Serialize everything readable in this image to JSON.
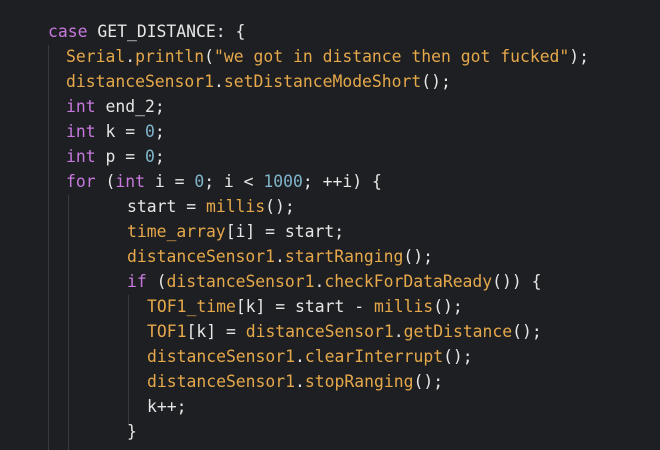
{
  "code": {
    "lines": [
      [
        {
          "t": "case",
          "c": "kw"
        },
        {
          "t": " GET_DISTANCE: {",
          "c": "id"
        }
      ],
      [
        {
          "t": "Serial",
          "c": "ob"
        },
        {
          "t": ".",
          "c": "pu"
        },
        {
          "t": "println",
          "c": "fn"
        },
        {
          "t": "(",
          "c": "pu"
        },
        {
          "t": "\"we got in distance then got fucked\"",
          "c": "st"
        },
        {
          "t": ");",
          "c": "pu"
        }
      ],
      [
        {
          "t": "distanceSensor1",
          "c": "ob"
        },
        {
          "t": ".",
          "c": "pu"
        },
        {
          "t": "setDistanceModeShort",
          "c": "fn"
        },
        {
          "t": "();",
          "c": "pu"
        }
      ],
      [
        {
          "t": "int",
          "c": "ty"
        },
        {
          "t": " end_2;",
          "c": "id"
        }
      ],
      [
        {
          "t": "int",
          "c": "ty"
        },
        {
          "t": " k = ",
          "c": "id"
        },
        {
          "t": "0",
          "c": "nm"
        },
        {
          "t": ";",
          "c": "pu"
        }
      ],
      [
        {
          "t": "int",
          "c": "ty"
        },
        {
          "t": " p = ",
          "c": "id"
        },
        {
          "t": "0",
          "c": "nm"
        },
        {
          "t": ";",
          "c": "pu"
        }
      ],
      [
        {
          "t": "for",
          "c": "kw"
        },
        {
          "t": " (",
          "c": "pu"
        },
        {
          "t": "int",
          "c": "ty"
        },
        {
          "t": " i = ",
          "c": "id"
        },
        {
          "t": "0",
          "c": "nm"
        },
        {
          "t": "; i < ",
          "c": "id"
        },
        {
          "t": "1000",
          "c": "nm"
        },
        {
          "t": "; ++i) {",
          "c": "id"
        }
      ],
      [
        {
          "t": "start = ",
          "c": "id"
        },
        {
          "t": "millis",
          "c": "fn"
        },
        {
          "t": "();",
          "c": "pu"
        }
      ],
      [
        {
          "t": "time_array",
          "c": "ob"
        },
        {
          "t": "[i] = start;",
          "c": "id"
        }
      ],
      [
        {
          "t": "distanceSensor1",
          "c": "ob"
        },
        {
          "t": ".",
          "c": "pu"
        },
        {
          "t": "startRanging",
          "c": "fn"
        },
        {
          "t": "();",
          "c": "pu"
        }
      ],
      [
        {
          "t": "if",
          "c": "kw"
        },
        {
          "t": " (",
          "c": "pu"
        },
        {
          "t": "distanceSensor1",
          "c": "ob"
        },
        {
          "t": ".",
          "c": "pu"
        },
        {
          "t": "checkForDataReady",
          "c": "fn"
        },
        {
          "t": "()) {",
          "c": "pu"
        }
      ],
      [
        {
          "t": "TOF1_time",
          "c": "ob"
        },
        {
          "t": "[k] = start - ",
          "c": "id"
        },
        {
          "t": "millis",
          "c": "fn"
        },
        {
          "t": "();",
          "c": "pu"
        }
      ],
      [
        {
          "t": "TOF1",
          "c": "ob"
        },
        {
          "t": "[k] = ",
          "c": "id"
        },
        {
          "t": "distanceSensor1",
          "c": "ob"
        },
        {
          "t": ".",
          "c": "pu"
        },
        {
          "t": "getDistance",
          "c": "fn"
        },
        {
          "t": "();",
          "c": "pu"
        }
      ],
      [
        {
          "t": "distanceSensor1",
          "c": "ob"
        },
        {
          "t": ".",
          "c": "pu"
        },
        {
          "t": "clearInterrupt",
          "c": "fn"
        },
        {
          "t": "();",
          "c": "pu"
        }
      ],
      [
        {
          "t": "distanceSensor1",
          "c": "ob"
        },
        {
          "t": ".",
          "c": "pu"
        },
        {
          "t": "stopRanging",
          "c": "fn"
        },
        {
          "t": "();",
          "c": "pu"
        }
      ],
      [
        {
          "t": "k++;",
          "c": "id"
        }
      ],
      [
        {
          "t": "}",
          "c": "pu"
        }
      ]
    ]
  }
}
